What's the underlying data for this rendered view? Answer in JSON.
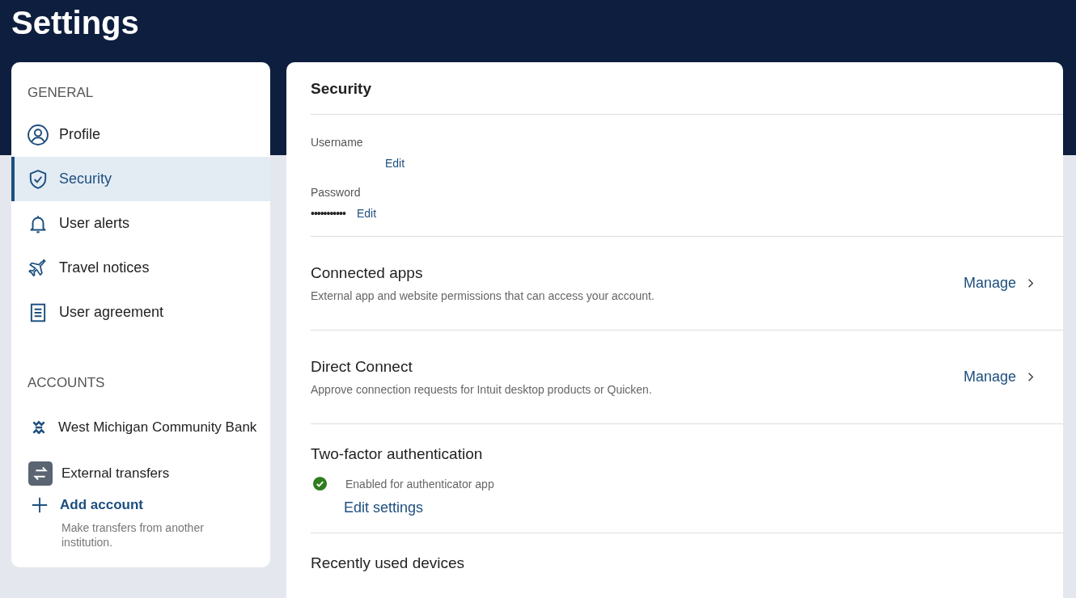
{
  "page": {
    "title": "Settings"
  },
  "sidebar": {
    "sections": [
      {
        "heading": "GENERAL",
        "items": [
          {
            "label": "Profile",
            "kind": "profile",
            "selected": false
          },
          {
            "label": "Security",
            "kind": "shield",
            "selected": true
          },
          {
            "label": "User alerts",
            "kind": "bell",
            "selected": false
          },
          {
            "label": "Travel notices",
            "kind": "plane",
            "selected": false
          },
          {
            "label": "User agreement",
            "kind": "document",
            "selected": false
          }
        ]
      },
      {
        "heading": "ACCOUNTS",
        "items": [
          {
            "label": "West Michigan Community Bank",
            "kind": "bank",
            "selected": false
          },
          {
            "label": "External transfers",
            "kind": "transfer",
            "selected": false
          }
        ]
      }
    ],
    "add_account": {
      "label": "Add account",
      "description": "Make transfers from another institution."
    }
  },
  "security": {
    "heading": "Security",
    "credentials": [
      {
        "label": "Username",
        "action": "Edit"
      },
      {
        "label": "Password",
        "value": "•••••••••••",
        "action": "Edit"
      }
    ],
    "rows": [
      {
        "title": "Connected apps",
        "description": "External app and website permissions that can access your account.",
        "action": "Manage"
      },
      {
        "title": "Direct Connect",
        "description": "Approve connection requests for Intuit desktop products or Quicken.",
        "action": "Manage"
      }
    ],
    "two_factor": {
      "title": "Two-factor authentication",
      "enabled": true,
      "status": "Enabled for authenticator app",
      "action": "Edit settings"
    },
    "devices": {
      "title": "Recently used devices"
    }
  }
}
